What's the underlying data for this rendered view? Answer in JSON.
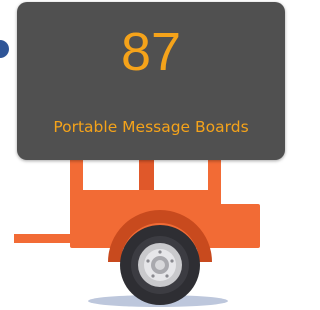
{
  "sign": {
    "count": "87",
    "caption": "Portable Message Boards"
  },
  "icons": {
    "trailer": "trailer-icon",
    "wheel": "wheel-icon"
  },
  "colors": {
    "panel": "#505050",
    "text": "#f5a31a",
    "trailer": "#f26b35",
    "trailer_dark": "#c84a1e",
    "tire": "#2e2e33",
    "rim": "#c9c9cc",
    "shadow": "#bdc7dc"
  }
}
